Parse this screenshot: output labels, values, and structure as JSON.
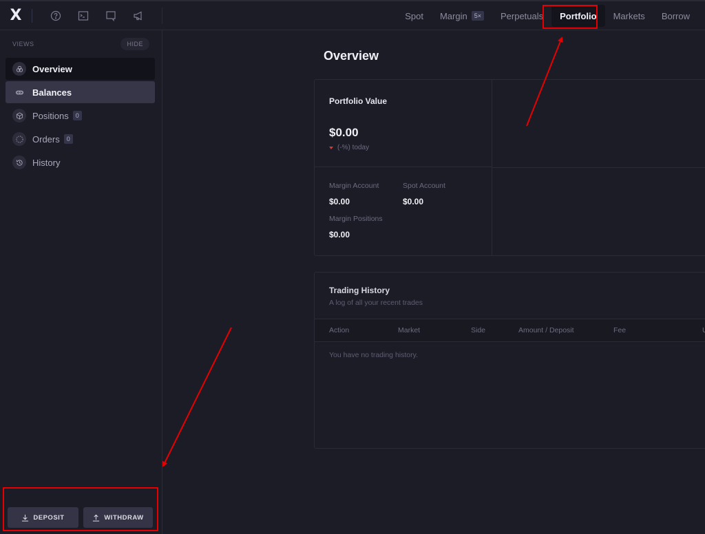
{
  "app": {
    "logo": "X"
  },
  "topbar": {
    "icons": [
      "help-icon",
      "terminal-icon",
      "chat-icon",
      "megaphone-icon"
    ],
    "nav": [
      {
        "label": "Spot",
        "active": false
      },
      {
        "label": "Margin",
        "badge": "5×",
        "active": false
      },
      {
        "label": "Perpetuals",
        "active": false
      },
      {
        "label": "Portfolio",
        "active": true
      },
      {
        "label": "Markets",
        "active": false
      },
      {
        "label": "Borrow",
        "active": false
      }
    ]
  },
  "sidebar": {
    "section_label": "VIEWS",
    "hide_label": "HIDE",
    "items": [
      {
        "label": "Overview",
        "icon": "overview-icon",
        "state": "selected"
      },
      {
        "label": "Balances",
        "icon": "balances-icon",
        "state": "hover"
      },
      {
        "label": "Positions",
        "icon": "cube-icon",
        "count": "0"
      },
      {
        "label": "Orders",
        "icon": "orders-icon",
        "count": "0"
      },
      {
        "label": "History",
        "icon": "history-icon"
      }
    ],
    "deposit_label": "DEPOSIT",
    "withdraw_label": "WITHDRAW"
  },
  "main": {
    "title": "Overview",
    "portfolio": {
      "title": "Portfolio Value",
      "value": "$0.00",
      "change": "(-%) today",
      "accounts": [
        {
          "label": "Margin Account",
          "value": "$0.00"
        },
        {
          "label": "Spot Account",
          "value": "$0.00"
        },
        {
          "label": "Margin Positions",
          "value": "$0.00"
        }
      ]
    },
    "history": {
      "title": "Trading History",
      "subtitle": "A log of all your recent trades",
      "columns": [
        "Action",
        "Market",
        "Side",
        "Amount / Deposit",
        "Fee",
        "U"
      ],
      "empty": "You have no trading history."
    }
  },
  "colors": {
    "background": "#1c1c27",
    "annotation": "#e80000",
    "down": "#e03535"
  }
}
